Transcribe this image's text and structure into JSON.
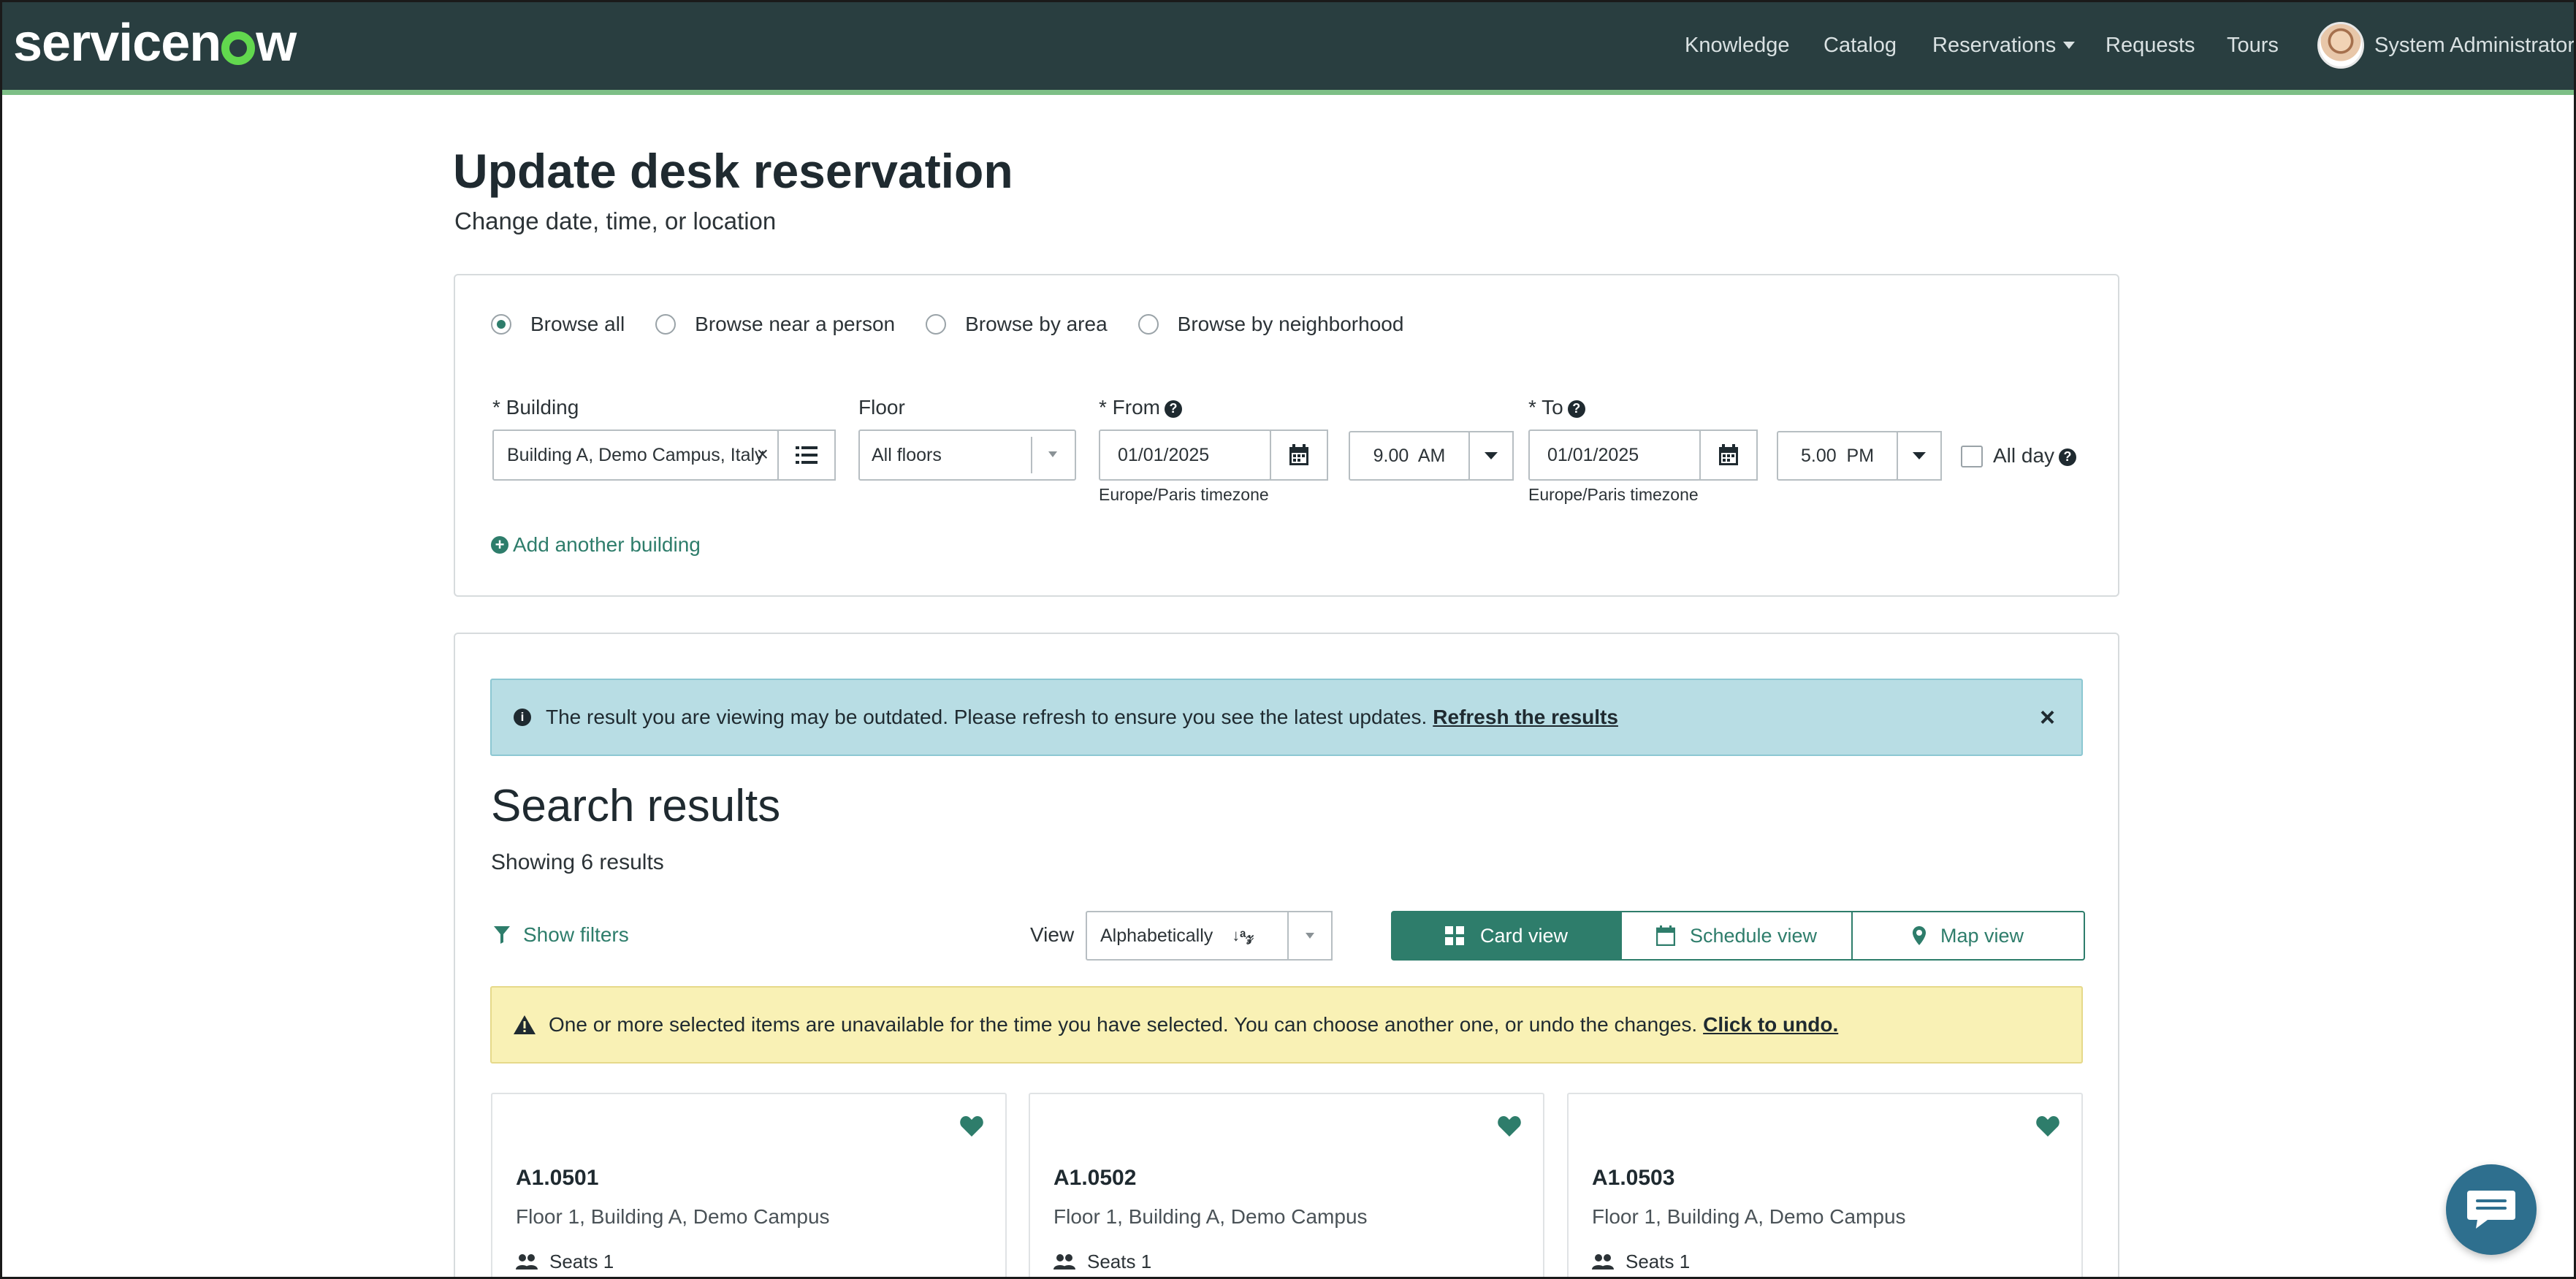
{
  "header": {
    "logo_text": "servicenow",
    "nav": [
      {
        "label": "Knowledge"
      },
      {
        "label": "Catalog"
      },
      {
        "label": "Reservations"
      },
      {
        "label": "Requests"
      },
      {
        "label": "Tours"
      }
    ],
    "user_name": "System Administrator"
  },
  "page": {
    "title": "Update desk reservation",
    "subtitle": "Change date, time, or location"
  },
  "browse": {
    "options": [
      {
        "label": "Browse all",
        "checked": true
      },
      {
        "label": "Browse near a person",
        "checked": false
      },
      {
        "label": "Browse by area",
        "checked": false
      },
      {
        "label": "Browse by neighborhood",
        "checked": false
      }
    ]
  },
  "form": {
    "building_label": "* Building",
    "building_value": "Building A, Demo Campus, Italy",
    "floor_label": "Floor",
    "floor_value": "All floors",
    "from_label": "* From",
    "from_date": "01/01/2025",
    "from_time": "9.00  AM",
    "from_tz": "Europe/Paris timezone",
    "to_label": "* To",
    "to_date": "01/01/2025",
    "to_time": "5.00  PM",
    "to_tz": "Europe/Paris timezone",
    "all_day_label": "All day",
    "add_building": "Add another building"
  },
  "info_banner": {
    "text": "The result you are viewing may be outdated. Please refresh to ensure you see the latest updates.",
    "link": "Refresh the results"
  },
  "results": {
    "title": "Search results",
    "count": "Showing 6 results",
    "show_filters": "Show filters",
    "view_label": "View",
    "sort_value": "Alphabetically",
    "views": [
      {
        "label": "Card view",
        "active": true
      },
      {
        "label": "Schedule view",
        "active": false
      },
      {
        "label": "Map view",
        "active": false
      }
    ]
  },
  "warn_banner": {
    "text": "One or more selected items are unavailable for the time you have selected. You can choose another one, or undo the changes.",
    "link": "Click to undo."
  },
  "cards": [
    {
      "name": "A1.0501",
      "location": "Floor 1, Building A, Demo Campus",
      "seats": "Seats 1"
    },
    {
      "name": "A1.0502",
      "location": "Floor 1, Building A, Demo Campus",
      "seats": "Seats 1"
    },
    {
      "name": "A1.0503",
      "location": "Floor 1, Building A, Demo Campus",
      "seats": "Seats 1"
    }
  ],
  "colors": {
    "header_bg": "#293e40",
    "accent_green": "#2e7d6b",
    "brand_green": "#62d84e",
    "info_bg": "#b8dde4",
    "warn_bg": "#f9f1b5"
  }
}
